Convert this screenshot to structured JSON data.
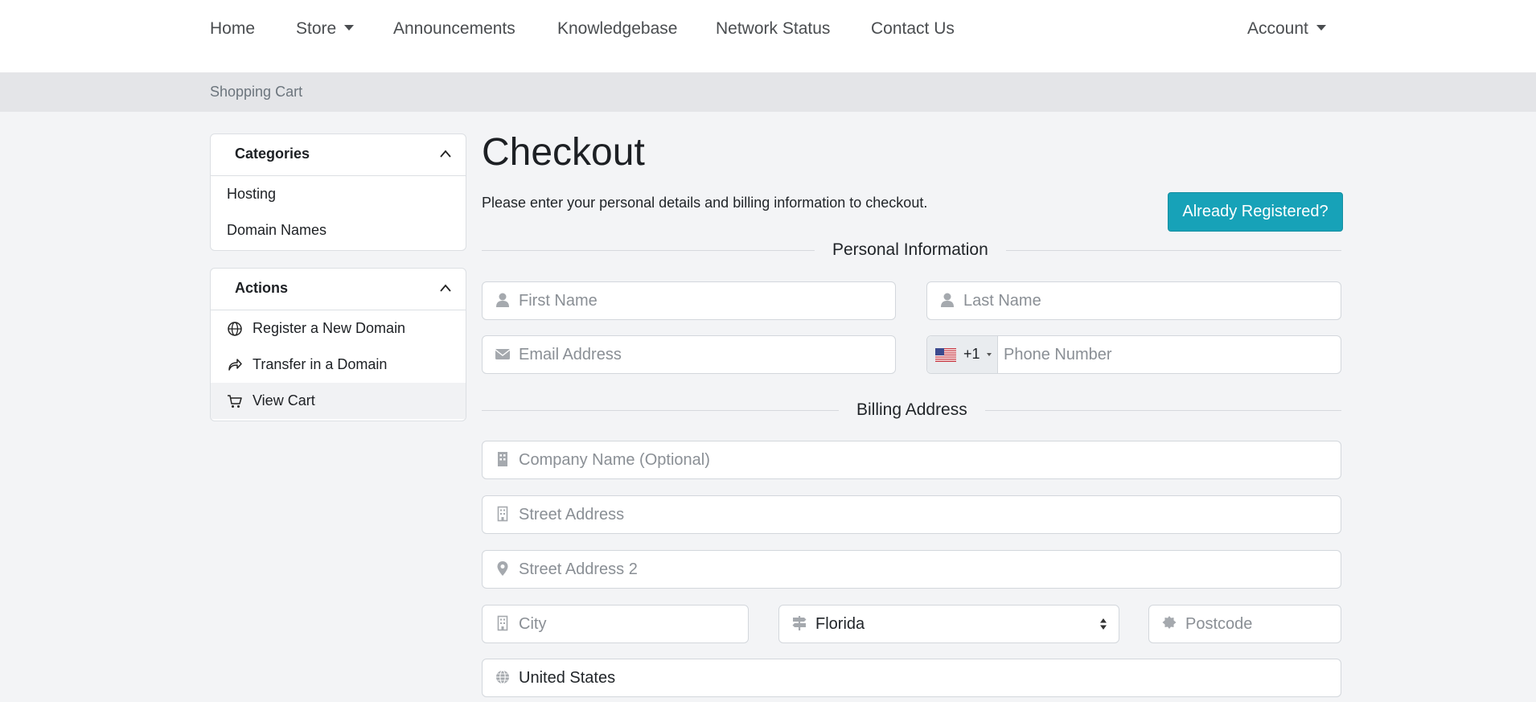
{
  "nav": {
    "items": [
      "Home",
      "Store",
      "Announcements",
      "Knowledgebase",
      "Network Status",
      "Contact Us"
    ],
    "account": "Account"
  },
  "breadcrumb": "Shopping Cart",
  "sidebar": {
    "categories": {
      "title": "Categories",
      "items": [
        "Hosting",
        "Domain Names"
      ]
    },
    "actions": {
      "title": "Actions",
      "items": [
        {
          "label": "Register a New Domain",
          "icon": "globe-icon"
        },
        {
          "label": "Transfer in a Domain",
          "icon": "share-arrow-icon"
        },
        {
          "label": "View Cart",
          "icon": "cart-icon"
        }
      ]
    }
  },
  "main": {
    "title": "Checkout",
    "lead": "Please enter your personal details and billing information to checkout.",
    "already_registered": "Already Registered?",
    "personal_heading": "Personal Information",
    "billing_heading": "Billing Address",
    "fields": {
      "first_name": "First Name",
      "last_name": "Last Name",
      "email": "Email Address",
      "phone_code": "+1",
      "phone": "Phone Number",
      "company": "Company Name (Optional)",
      "street": "Street Address",
      "street2": "Street Address 2",
      "city": "City",
      "state": "Florida",
      "postcode": "Postcode",
      "country": "United States"
    }
  },
  "colors": {
    "accent": "#17a2b8",
    "background": "#f3f4f6"
  }
}
